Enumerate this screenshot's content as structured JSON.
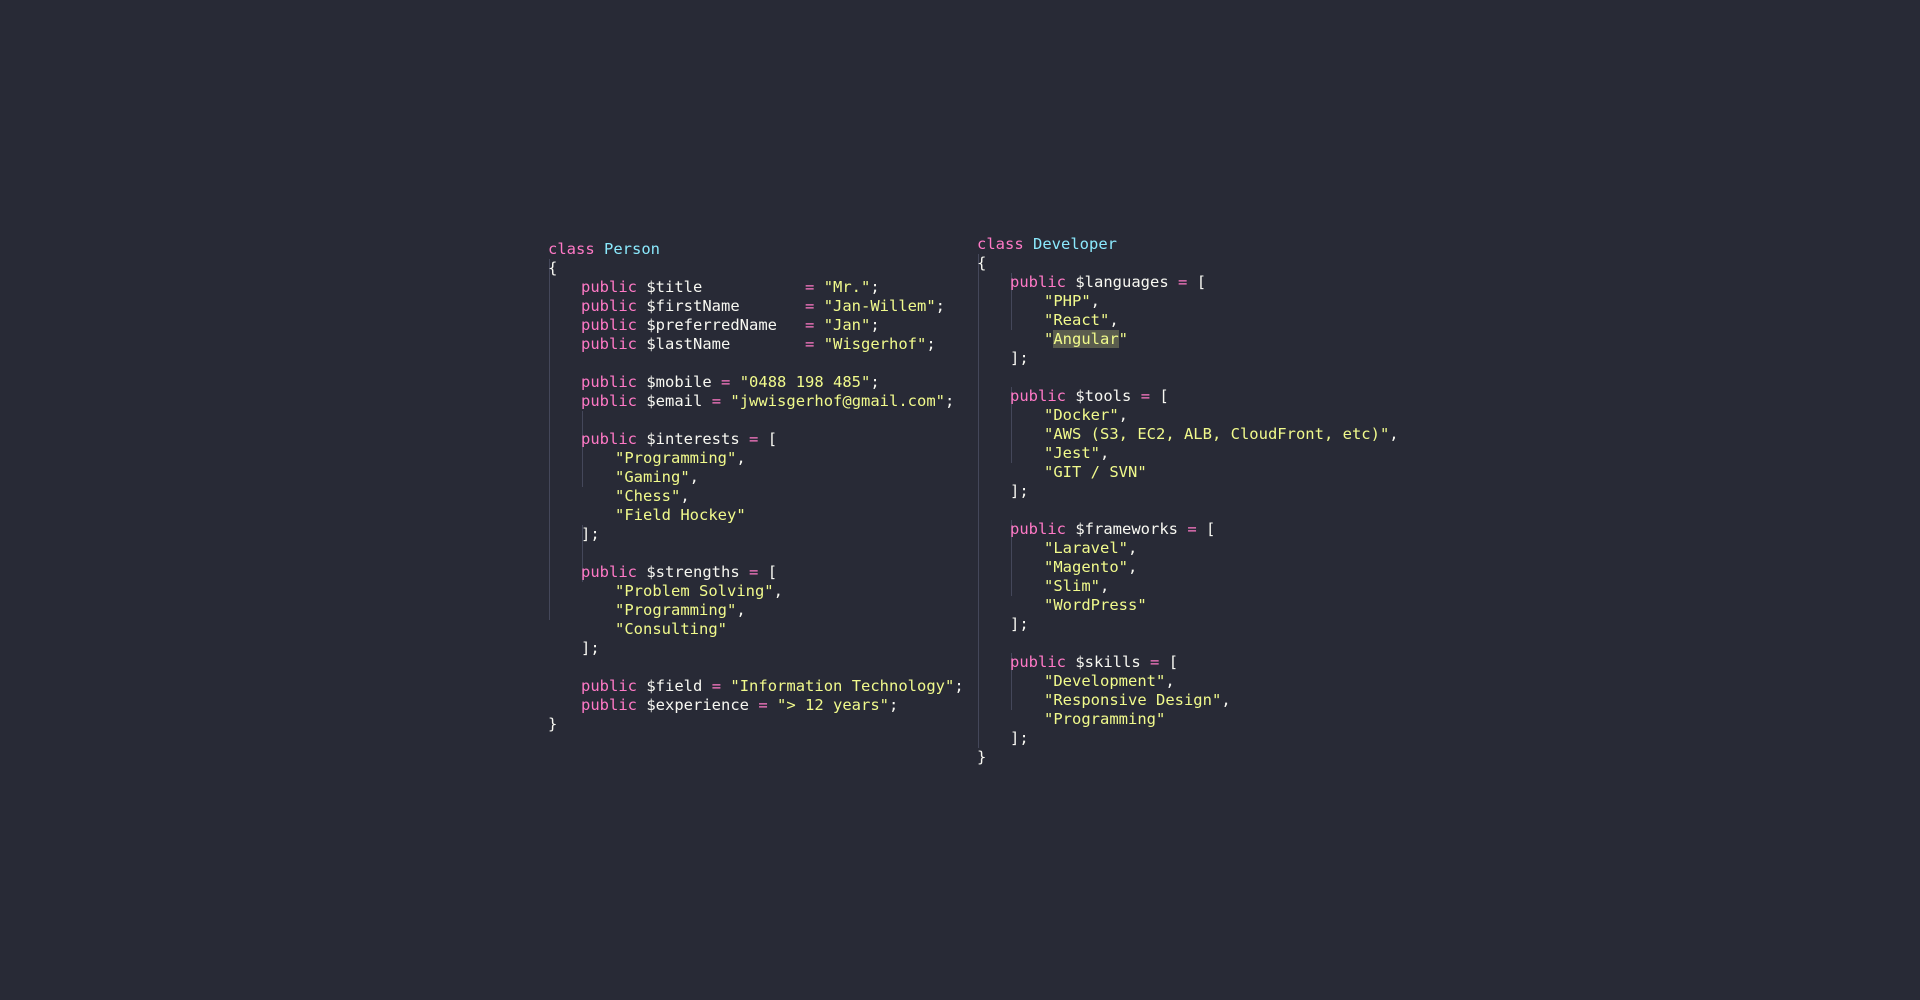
{
  "person": {
    "keyword_class": "class",
    "class_name": "Person",
    "open_brace": "{",
    "close_brace": "}",
    "keyword_public": "public",
    "title": {
      "var": "$title          ",
      "value": "\"Mr.\""
    },
    "firstName": {
      "var": "$firstName      ",
      "value": "\"Jan-Willem\""
    },
    "preferredName": {
      "var": "$preferredName  ",
      "value": "\"Jan\""
    },
    "lastName": {
      "var": "$lastName       ",
      "value": "\"Wisgerhof\""
    },
    "mobile": {
      "var": "$mobile",
      "value": "\"0488 198 485\""
    },
    "email": {
      "var": "$email",
      "value": "\"jwwisgerhof@gmail.com\""
    },
    "interests": {
      "var": "$interests",
      "items": [
        "\"Programming\"",
        "\"Gaming\"",
        "\"Chess\"",
        "\"Field Hockey\""
      ]
    },
    "strengths": {
      "var": "$strengths",
      "items": [
        "\"Problem Solving\"",
        "\"Programming\"",
        "\"Consulting\""
      ]
    },
    "field": {
      "var": "$field",
      "value": "\"Information Technology\""
    },
    "experience": {
      "var": "$experience",
      "value": "\"> 12 years\""
    }
  },
  "developer": {
    "keyword_class": "class",
    "class_name": "Developer",
    "open_brace": "{",
    "close_brace": "}",
    "keyword_public": "public",
    "languages": {
      "var": "$languages",
      "items": [
        "\"PHP\"",
        "\"React\"",
        "Angular"
      ]
    },
    "tools": {
      "var": "$tools",
      "items": [
        "\"Docker\"",
        "\"AWS (S3, EC2, ALB, CloudFront, etc)\"",
        "\"Jest\"",
        "\"GIT / SVN\""
      ]
    },
    "frameworks": {
      "var": "$frameworks",
      "items": [
        "\"Laravel\"",
        "\"Magento\"",
        "\"Slim\"",
        "\"WordPress\""
      ]
    },
    "skills": {
      "var": "$skills",
      "items": [
        "\"Development\"",
        "\"Responsive Design\"",
        "\"Programming\""
      ]
    }
  },
  "symbols": {
    "assign": "=",
    "semicolon": ";",
    "comma": ",",
    "open_bracket": "[",
    "close_bracket": "];",
    "quote": "\""
  },
  "colors": {
    "background": "#282a36",
    "keyword": "#ff79c6",
    "class_name": "#8be9fd",
    "string": "#f1fa8c",
    "text": "#f8f8f2",
    "indent_guide": "#44475a"
  }
}
